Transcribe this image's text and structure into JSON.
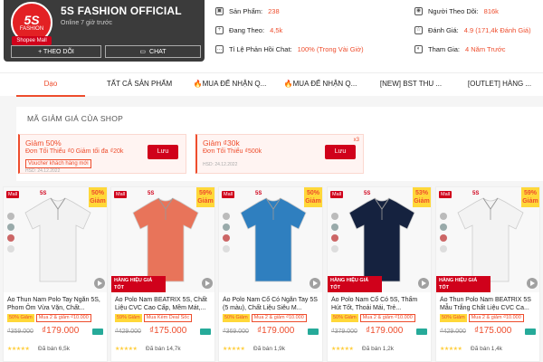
{
  "shop": {
    "name": "5S FASHION OFFICIAL",
    "status": "Online 7 giờ trước",
    "logo_text": "5S",
    "logo_sub": "FASHION",
    "mall_label": "Shopee Mall",
    "follow_label": "+ THEO DÕI",
    "chat_label": "CHAT"
  },
  "stats": {
    "products_label": "Sản Phẩm:",
    "products_value": "238",
    "following_label": "Đang Theo:",
    "following_value": "4,5k",
    "response_label": "Tỉ Lệ Phản Hồi Chat:",
    "response_value": "100% (Trong Vài Giờ)",
    "followers_label": "Người Theo Dõi:",
    "followers_value": "816k",
    "rating_label": "Đánh Giá:",
    "rating_value": "4.9 (171,4k Đánh Giá)",
    "joined_label": "Tham Gia:",
    "joined_value": "4 Năm Trước"
  },
  "tabs": [
    {
      "label": "Dạo"
    },
    {
      "label": "TẤT CẢ SẢN PHẨM"
    },
    {
      "label": "🔥MUA ĐỂ NHẬN Q..."
    },
    {
      "label": "🔥MUA ĐỂ NHẬN Q..."
    },
    {
      "label": "[NEW] BST THU ..."
    },
    {
      "label": "[OUTLET] HÀNG ..."
    }
  ],
  "vouchers": {
    "section_title": "MÃ GIẢM GIÁ CỦA SHOP",
    "items": [
      {
        "title": "Giảm 50%",
        "desc": "Đơn Tối Thiểu ₫0 Giảm tối đa ₫20k",
        "tag": "Voucher khách hàng mới",
        "expiry": "HSD: 24.12.2022",
        "button": "Lưu",
        "mult": ""
      },
      {
        "title": "Giảm ₫30k",
        "desc": "Đơn Tối Thiểu ₫500k",
        "tag": "",
        "expiry": "HSD: 24.12.2022",
        "button": "Lưu",
        "mult": "x3"
      }
    ]
  },
  "products": [
    {
      "name": "Áo Thun Nam Polo Tay Ngắn 5S, Phom Ôm Vừa Vặn, Chất...",
      "discount_badge": "50% Giảm",
      "tag_discount": "50% Giảm",
      "tag_deal": "Mua 2 & giảm ₫10.000",
      "old_price": "₫359.000",
      "new_price": "₫179.000",
      "sold": "Đã bán 6,5k",
      "stars": "★★★★★",
      "shirt_color": "#f2f2f2",
      "hot": false
    },
    {
      "name": "Áo Polo Nam BEATRIX 5S, Chất Liệu CVC Cao Cấp, Mềm Mát,...",
      "discount_badge": "59% Giảm",
      "tag_discount": "59% Giảm",
      "tag_deal": "Mua Kèm Deal Sốc",
      "old_price": "₫429.000",
      "new_price": "₫175.000",
      "sold": "Đã bán 14,7k",
      "stars": "★★★★★",
      "shirt_color": "#e8745a",
      "hot": true,
      "hot_text": "HÀNG HIỆU GIÁ TỐT"
    },
    {
      "name": "Áo Polo Nam Cổ Có Ngắn Tay 5S (5 màu), Chất Liệu Siêu M...",
      "discount_badge": "50% Giảm",
      "tag_discount": "50% Giảm",
      "tag_deal": "Mua 2 & giảm ₫10.000",
      "old_price": "₫369.000",
      "new_price": "₫179.000",
      "sold": "Đã bán 1,9k",
      "stars": "★★★★★",
      "shirt_color": "#2f7fbf",
      "hot": false
    },
    {
      "name": "Áo Polo Nam Cổ Có 5S, Thấm Hút Tốt, Thoải Mái, Trẻ...",
      "discount_badge": "53% Giảm",
      "tag_discount": "50% Giảm",
      "tag_deal": "Mua 2 & giảm ₫10.000",
      "old_price": "₫379.000",
      "new_price": "₫179.000",
      "sold": "Đã bán 1,2k",
      "stars": "★★★★★",
      "shirt_color": "#15223f",
      "hot": true,
      "hot_text": "HÀNG HIỆU GIÁ TỐT"
    },
    {
      "name": "Áo Thun Polo Nam BEATRIX 5S Mẫu Trắng Chất Liệu CVC Ca...",
      "discount_badge": "59% Giảm",
      "tag_discount": "50% Giảm",
      "tag_deal": "Mua 2 & giảm ₫10.000",
      "old_price": "₫429.000",
      "new_price": "₫175.000",
      "sold": "Đã bán 1,4k",
      "stars": "★★★★★",
      "shirt_color": "#f3f3f3",
      "hot": true,
      "hot_text": "HÀNG HIỆU GIÁ TỐT"
    }
  ],
  "mall_tag": "Mall",
  "brand_mini": "5S"
}
